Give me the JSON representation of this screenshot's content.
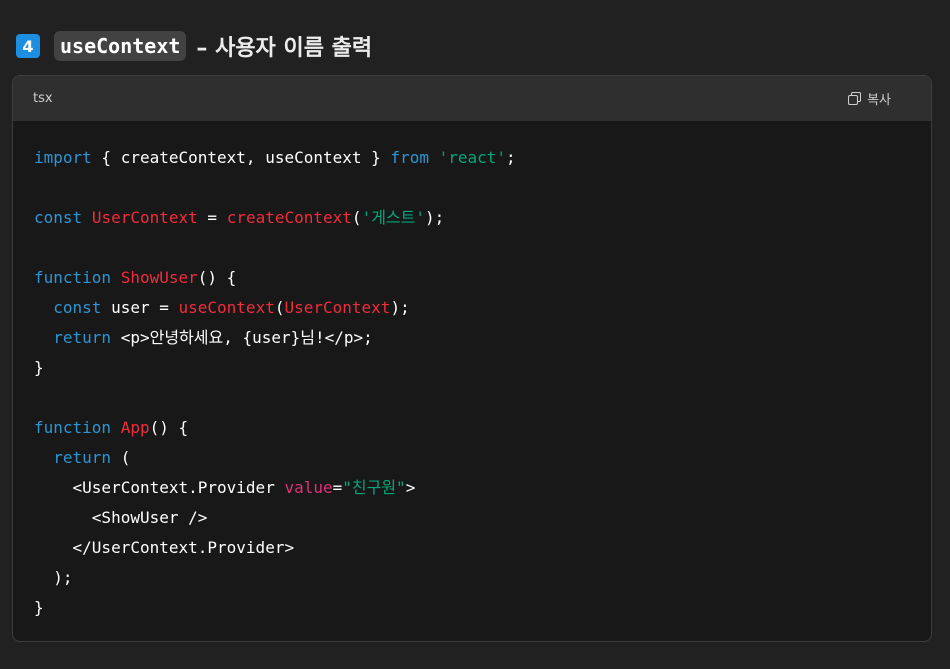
{
  "heading": {
    "badge": "4",
    "inline_code": "useContext",
    "rest": " – 사용자 이름 출력"
  },
  "code_block": {
    "language": "tsx",
    "copy_label": "복사",
    "lines": [
      [
        [
          "kw",
          "import"
        ],
        [
          "plain",
          " { createContext, useContext } "
        ],
        [
          "kw",
          "from"
        ],
        [
          "plain",
          " "
        ],
        [
          "str",
          "'react'"
        ],
        [
          "plain",
          ";"
        ]
      ],
      [],
      [
        [
          "kw",
          "const"
        ],
        [
          "plain",
          " "
        ],
        [
          "fn",
          "UserContext"
        ],
        [
          "plain",
          " = "
        ],
        [
          "fn",
          "createContext"
        ],
        [
          "plain",
          "("
        ],
        [
          "str",
          "'게스트'"
        ],
        [
          "plain",
          ");"
        ]
      ],
      [],
      [
        [
          "kw",
          "function"
        ],
        [
          "plain",
          " "
        ],
        [
          "fn",
          "ShowUser"
        ],
        [
          "plain",
          "() {"
        ]
      ],
      [
        [
          "plain",
          "  "
        ],
        [
          "kw",
          "const"
        ],
        [
          "plain",
          " user = "
        ],
        [
          "fn",
          "useContext"
        ],
        [
          "plain",
          "("
        ],
        [
          "fn",
          "UserContext"
        ],
        [
          "plain",
          ");"
        ]
      ],
      [
        [
          "plain",
          "  "
        ],
        [
          "kw",
          "return"
        ],
        [
          "plain",
          " <p>안녕하세요, {user}님!</p>;"
        ]
      ],
      [
        [
          "plain",
          "}"
        ]
      ],
      [],
      [
        [
          "kw",
          "function"
        ],
        [
          "plain",
          " "
        ],
        [
          "fn",
          "App"
        ],
        [
          "plain",
          "() {"
        ]
      ],
      [
        [
          "plain",
          "  "
        ],
        [
          "kw",
          "return"
        ],
        [
          "plain",
          " ("
        ]
      ],
      [
        [
          "plain",
          "    <UserContext.Provider "
        ],
        [
          "attr",
          "value"
        ],
        [
          "plain",
          "="
        ],
        [
          "str",
          "\"친구원\""
        ],
        [
          "plain",
          ">"
        ]
      ],
      [
        [
          "plain",
          "      <ShowUser />"
        ]
      ],
      [
        [
          "plain",
          "    </UserContext.Provider>"
        ]
      ],
      [
        [
          "plain",
          "  );"
        ]
      ],
      [
        [
          "plain",
          "}"
        ]
      ]
    ]
  },
  "colors": {
    "keyword": "#2e95d3",
    "function": "#f22c3d",
    "string": "#00a67d",
    "attribute": "#df3079",
    "badge": "#1d8fe0"
  },
  "icons": {
    "copy": "copy-icon"
  }
}
